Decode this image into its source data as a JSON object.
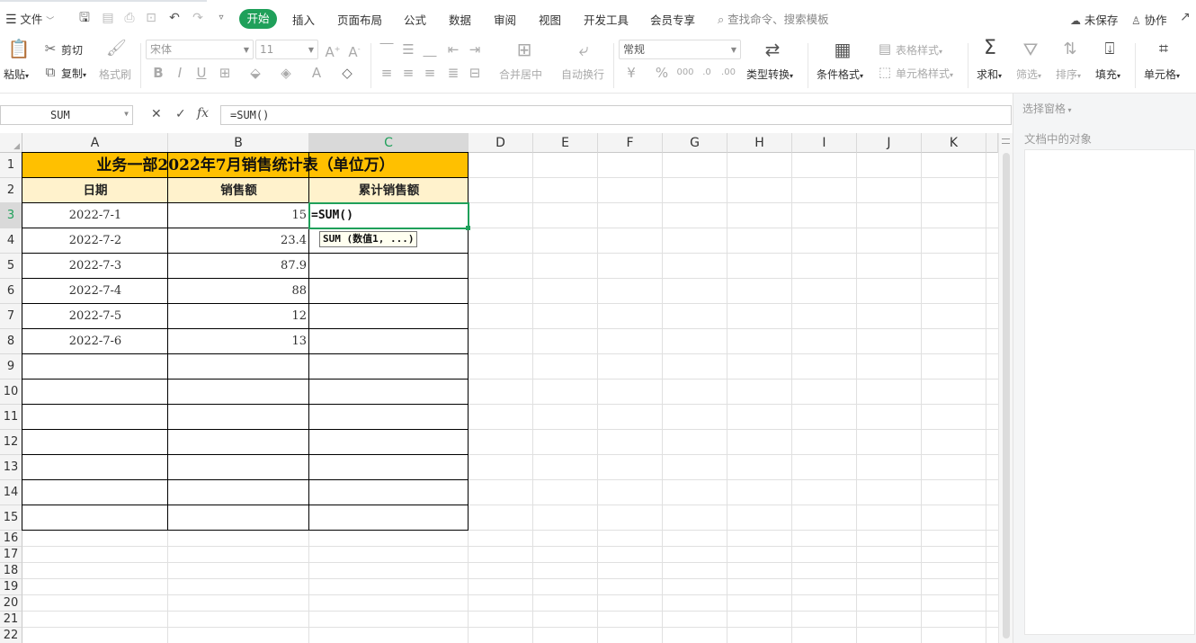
{
  "menubar": {
    "file_label": "文件",
    "tabs": [
      {
        "label": "开始",
        "active": true
      },
      {
        "label": "插入"
      },
      {
        "label": "页面布局"
      },
      {
        "label": "公式"
      },
      {
        "label": "数据"
      },
      {
        "label": "审阅"
      },
      {
        "label": "视图"
      },
      {
        "label": "开发工具"
      },
      {
        "label": "会员专享"
      }
    ],
    "search_placeholder": "查找命令、搜索模板",
    "unsaved_label": "未保存",
    "collab_label": "协作"
  },
  "ribbon": {
    "paste": "粘贴",
    "cut": "剪切",
    "copy": "复制",
    "format_painter": "格式刷",
    "font_name": "宋体",
    "font_size": "11",
    "merge_center": "合并居中",
    "wrap_text": "自动换行",
    "number_format": "常规",
    "type_convert": "类型转换",
    "cond_format": "条件格式",
    "table_style": "表格样式",
    "cell_style": "单元格样式",
    "sum": "求和",
    "filter": "筛选",
    "sort": "排序",
    "fill": "填充",
    "cell": "单元格"
  },
  "formula_bar": {
    "name_box": "SUM",
    "fx": "fx",
    "formula": "=SUM()"
  },
  "sheet": {
    "columns": [
      "A",
      "B",
      "C",
      "D",
      "E",
      "F",
      "G",
      "H",
      "I",
      "J",
      "K"
    ],
    "active_column": "C",
    "active_row": "3",
    "rows": [
      "1",
      "2",
      "3",
      "4",
      "5",
      "6",
      "7",
      "8",
      "9",
      "10",
      "11",
      "12",
      "13",
      "14",
      "15",
      "16",
      "17",
      "18",
      "19",
      "20",
      "21",
      "22"
    ],
    "title": "业务一部2022年7月销售统计表（单位万）",
    "headers": [
      "日期",
      "销售额",
      "累计销售额"
    ],
    "data": [
      {
        "date": "2022-7-1",
        "sales": "15"
      },
      {
        "date": "2022-7-2",
        "sales": "23.4"
      },
      {
        "date": "2022-7-3",
        "sales": "87.9"
      },
      {
        "date": "2022-7-4",
        "sales": "88"
      },
      {
        "date": "2022-7-5",
        "sales": "12"
      },
      {
        "date": "2022-7-6",
        "sales": "13"
      }
    ],
    "editing_text": "=SUM()",
    "tooltip": "SUM (数值1, ...)",
    "title_bg": "#ffc000",
    "header_bg": "#fff2cc",
    "active_color": "#1fa05a"
  },
  "side_panel": {
    "title": "选择窗格",
    "subtitle": "文档中的对象"
  }
}
